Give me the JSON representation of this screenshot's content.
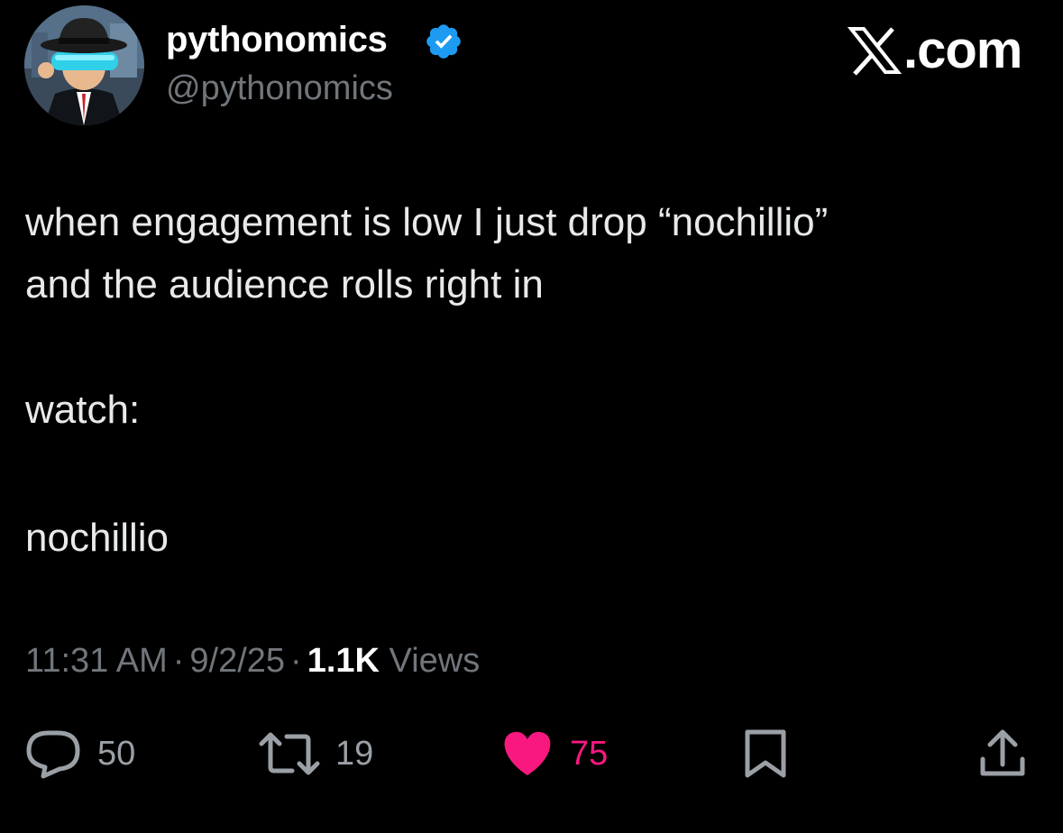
{
  "author": {
    "display_name": "pythonomics",
    "handle": "@pythonomics",
    "verified": true,
    "avatar_icon": "avatar-image",
    "verified_color": "#1d9bf0"
  },
  "brand": {
    "text": ".com",
    "logo_icon": "x-logo-icon"
  },
  "tweet": {
    "line1": "when engagement is low I just drop “nochillio”",
    "line2": "and the audience rolls right in",
    "line3": "watch:",
    "line4": "nochillio"
  },
  "meta": {
    "time": "11:31 AM",
    "separator": "·",
    "date": "9/2/25",
    "views_count": "1.1K",
    "views_label": "Views"
  },
  "actions": {
    "reply": {
      "icon": "reply-icon",
      "count": "50"
    },
    "repost": {
      "icon": "repost-icon",
      "count": "19"
    },
    "like": {
      "icon": "heart-icon",
      "count": "75",
      "liked": true,
      "color": "#f91880"
    },
    "bookmark": {
      "icon": "bookmark-icon"
    },
    "share": {
      "icon": "share-icon"
    }
  },
  "colors": {
    "background": "#000000",
    "text_primary": "#e7e9ea",
    "text_secondary": "#71767b",
    "accent_like": "#f91880",
    "accent_verified": "#1d9bf0"
  }
}
